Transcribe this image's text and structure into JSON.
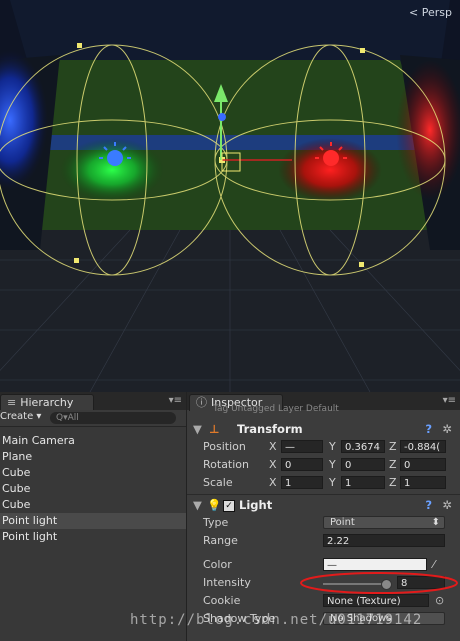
{
  "scene": {
    "camera_mode": "Persp",
    "light_colors": {
      "blue": "#1a4fff",
      "green": "#19e03a",
      "red": "#ff1515"
    }
  },
  "hierarchy": {
    "tab_label": "Hierarchy",
    "create_label": "Create ▾",
    "search_placeholder": "Q▾All",
    "items": [
      {
        "label": "Main Camera"
      },
      {
        "label": "Plane"
      },
      {
        "label": "Cube"
      },
      {
        "label": "Cube"
      },
      {
        "label": "Cube"
      },
      {
        "label": "Point light"
      },
      {
        "label": "Point light"
      }
    ]
  },
  "inspector": {
    "tab_label": "Inspector",
    "header_partial": "Tag  Untagged    Layer  Default",
    "transform": {
      "title": "Transform",
      "position": {
        "label": "Position",
        "x": "—",
        "y": "0.3674",
        "z": "-0.884("
      },
      "rotation": {
        "label": "Rotation",
        "x": "0",
        "y": "0",
        "z": "0"
      },
      "scale": {
        "label": "Scale",
        "x": "1",
        "y": "1",
        "z": "1"
      }
    },
    "light": {
      "title": "Light",
      "type_label": "Type",
      "type_value": "Point",
      "range_label": "Range",
      "range_value": "2.22",
      "color_label": "Color",
      "color_value": "—",
      "intensity_label": "Intensity",
      "intensity_value": "8",
      "cookie_label": "Cookie",
      "cookie_value": "None (Texture)",
      "shadow_label": "Shadow Type",
      "shadow_value": "No Shadows"
    }
  },
  "watermark": "http://blog.csdn.net/u011719142"
}
